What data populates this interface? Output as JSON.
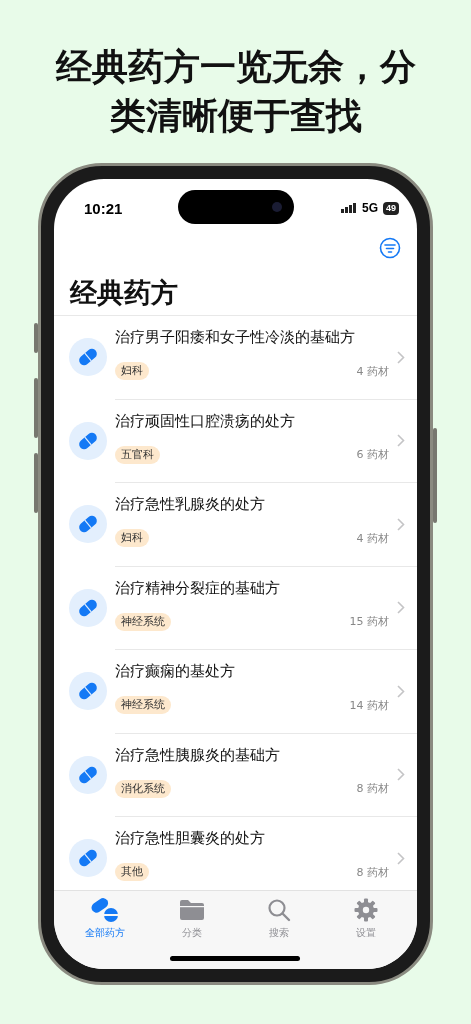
{
  "headline": "经典药方一览无余，分类清晰便于查找",
  "status_bar": {
    "time": "10:21",
    "network": "5G",
    "battery": "49"
  },
  "title": "经典药方",
  "formulas": [
    {
      "name": "治疗男子阳痿和女子性冷淡的基础方",
      "tag": "妇科",
      "count": "4 药材"
    },
    {
      "name": "治疗顽固性口腔溃疡的处方",
      "tag": "五官科",
      "count": "6 药材"
    },
    {
      "name": "治疗急性乳腺炎的处方",
      "tag": "妇科",
      "count": "4 药材"
    },
    {
      "name": "治疗精神分裂症的基础方",
      "tag": "神经系统",
      "count": "15 药材"
    },
    {
      "name": "治疗癫痫的基处方",
      "tag": "神经系统",
      "count": "14 药材"
    },
    {
      "name": "治疗急性胰腺炎的基础方",
      "tag": "消化系统",
      "count": "8 药材"
    },
    {
      "name": "治疗急性胆囊炎的处方",
      "tag": "其他",
      "count": "8 药材"
    }
  ],
  "tab_bar": [
    {
      "label": "全部药方",
      "kind": "pills",
      "selected": true
    },
    {
      "label": "分类",
      "kind": "folder",
      "selected": false
    },
    {
      "label": "搜索",
      "kind": "search",
      "selected": false
    },
    {
      "label": "设置",
      "kind": "gear",
      "selected": false
    }
  ]
}
